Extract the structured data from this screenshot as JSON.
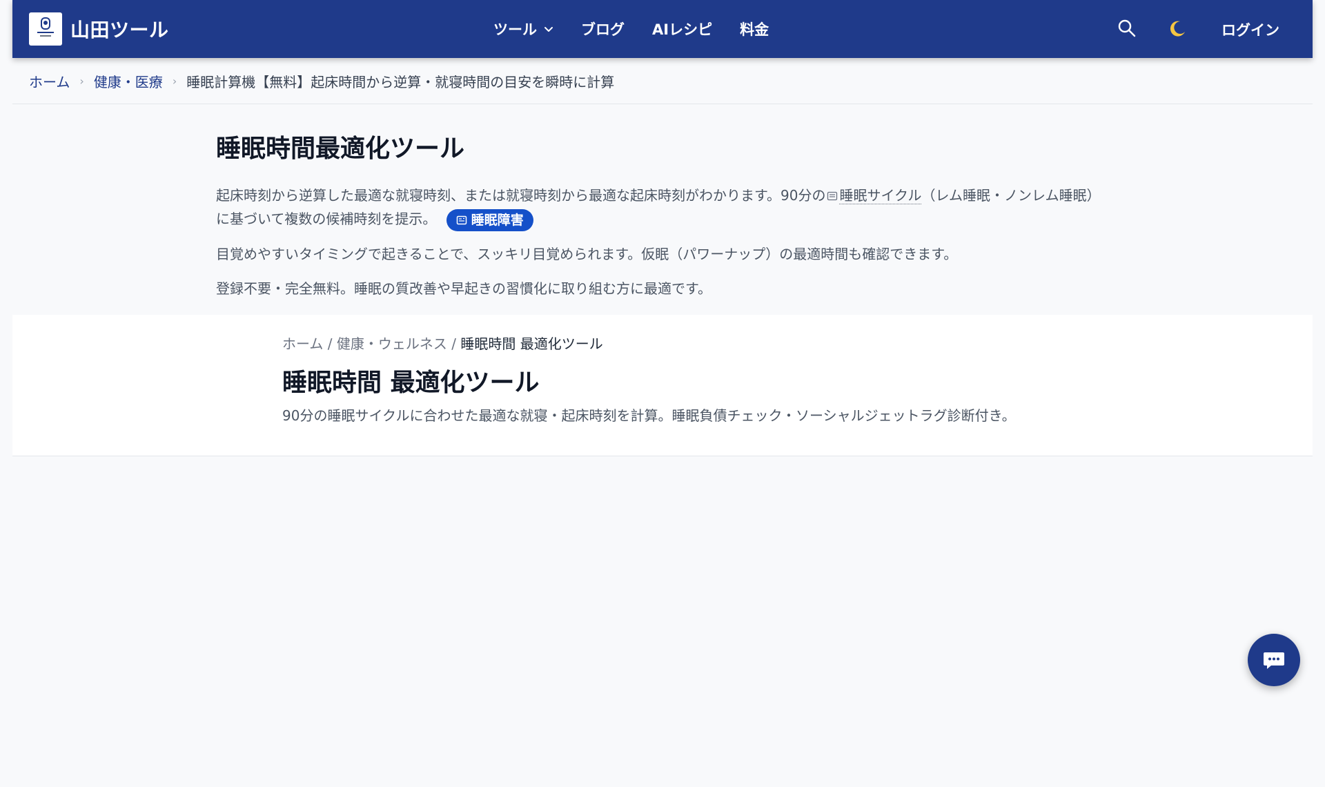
{
  "header": {
    "site_title": "山田ツール",
    "nav": [
      {
        "label": "ツール",
        "has_dropdown": true
      },
      {
        "label": "ブログ"
      },
      {
        "label": "AIレシピ"
      },
      {
        "label": "料金"
      }
    ],
    "search_icon": "search-icon",
    "theme_icon": "moon-icon",
    "login_label": "ログイン",
    "colors": {
      "header_bg": "#1f3a8a",
      "accent": "#1550c9"
    }
  },
  "breadcrumb": {
    "home": "ホーム",
    "category": "健康・医療",
    "current": "睡眠計算機【無料】起床時間から逆算・就寝時間の目安を瞬時に計算"
  },
  "intro": {
    "title": "睡眠時間最適化ツール",
    "p1_a": "起床時刻から逆算した最適な就寝時刻、または就寝時刻から最適な起床時刻がわかります。90分の",
    "p1_term": "睡眠サイクル",
    "p1_b": "（レム睡眠・ノンレム睡眠）に基づいて複数の候補時刻を提示。",
    "tag_label": "睡眠障害",
    "p2": "目覚めやすいタイミングで起きることで、スッキリ目覚められます。仮眠（パワーナップ）の最適時間も確認できます。",
    "p3": "登録不要・完全無料。睡眠の質改善や早起きの習慣化に取り組む方に最適です。"
  },
  "card": {
    "crumb_home": "ホーム",
    "crumb_sep": "/",
    "crumb_category": "健康・ウェルネス",
    "crumb_current": "睡眠時間 最適化ツール",
    "title": "睡眠時間 最適化ツール",
    "description": "90分の睡眠サイクルに合わせた最適な就寝・起床時刻を計算。睡眠負債チェック・ソーシャルジェットラグ診断付き。"
  },
  "chat_button": {
    "icon": "chat-bubble-icon"
  }
}
